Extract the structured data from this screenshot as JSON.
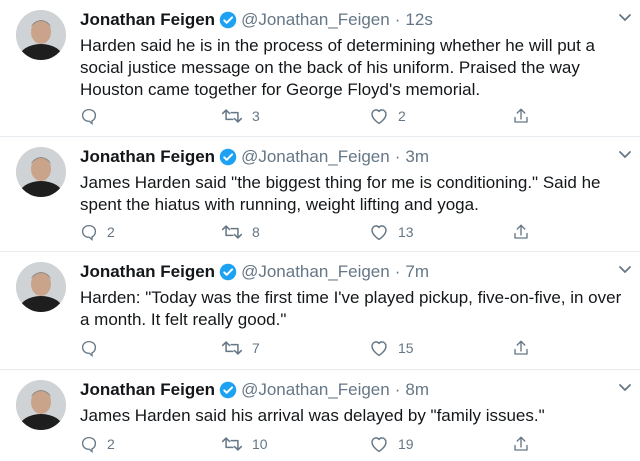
{
  "tweets": [
    {
      "name": "Jonathan Feigen",
      "handle": "@Jonathan_Feigen",
      "time": "12s",
      "text": "Harden said he is in the process of determining whether he will put a social justice message on the back of his uniform. Praised the way Houston came together for George Floyd's memorial.",
      "replies": "",
      "retweets": "3",
      "likes": "2"
    },
    {
      "name": "Jonathan Feigen",
      "handle": "@Jonathan_Feigen",
      "time": "3m",
      "text": "James Harden said \"the biggest thing for me is conditioning.\" Said he spent the hiatus with running, weight lifting and yoga.",
      "replies": "2",
      "retweets": "8",
      "likes": "13"
    },
    {
      "name": "Jonathan Feigen",
      "handle": "@Jonathan_Feigen",
      "time": "7m",
      "text": "Harden: \"Today was the first time I've played pickup, five-on-five, in over a month. It felt really good.\"",
      "replies": "",
      "retweets": "7",
      "likes": "15"
    },
    {
      "name": "Jonathan Feigen",
      "handle": "@Jonathan_Feigen",
      "time": "8m",
      "text": "James Harden said his arrival was delayed by \"family issues.\"",
      "replies": "2",
      "retweets": "10",
      "likes": "19"
    }
  ],
  "colors": {
    "verified": "#1da1f2",
    "muted": "#657786",
    "text": "#14171a"
  },
  "icons": [
    "verified-badge-icon",
    "chevron-down-icon",
    "reply-icon",
    "retweet-icon",
    "like-icon",
    "share-icon"
  ]
}
